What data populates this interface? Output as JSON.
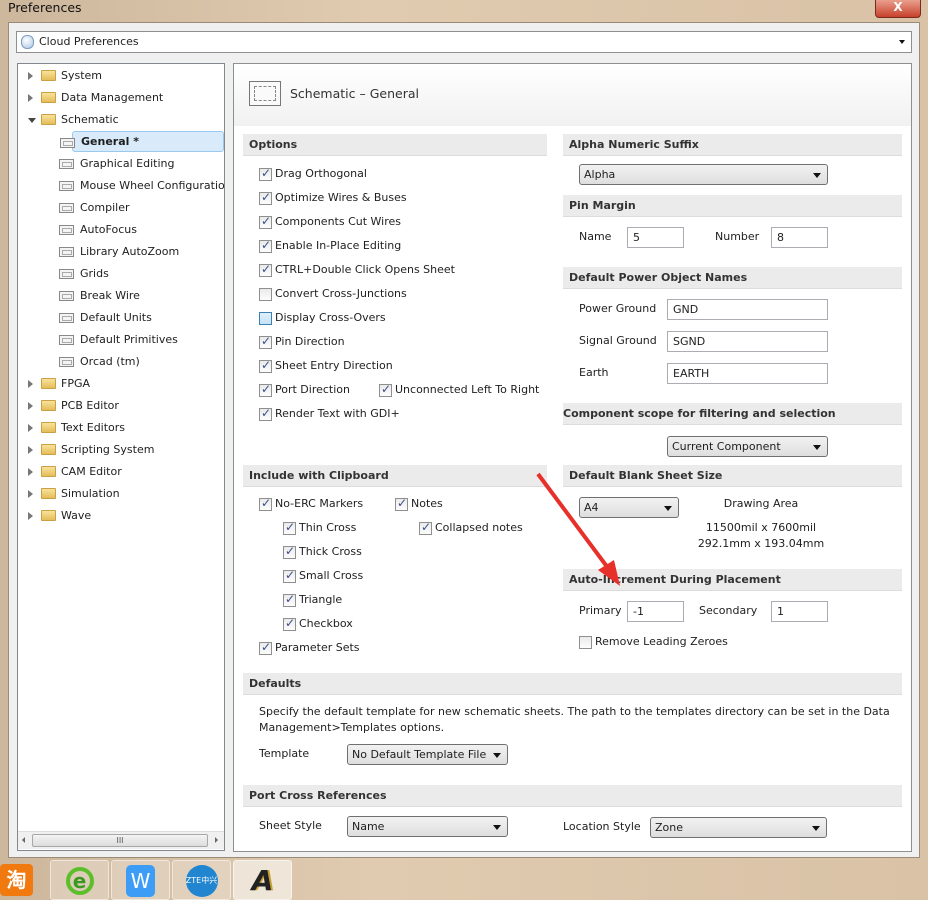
{
  "window": {
    "title": "Preferences",
    "close_label": "X"
  },
  "profile_select": {
    "value": "Cloud Preferences"
  },
  "tree": [
    {
      "label": "System",
      "level": 0,
      "expanded": false
    },
    {
      "label": "Data Management",
      "level": 0,
      "expanded": false
    },
    {
      "label": "Schematic",
      "level": 0,
      "expanded": true
    },
    {
      "label": "General *",
      "level": 1,
      "selected": true
    },
    {
      "label": "Graphical Editing",
      "level": 1
    },
    {
      "label": "Mouse Wheel Configuration",
      "level": 1
    },
    {
      "label": "Compiler",
      "level": 1
    },
    {
      "label": "AutoFocus",
      "level": 1
    },
    {
      "label": "Library AutoZoom",
      "level": 1
    },
    {
      "label": "Grids",
      "level": 1
    },
    {
      "label": "Break Wire",
      "level": 1
    },
    {
      "label": "Default Units",
      "level": 1
    },
    {
      "label": "Default Primitives",
      "level": 1
    },
    {
      "label": "Orcad (tm)",
      "level": 1
    },
    {
      "label": "FPGA",
      "level": 0,
      "expanded": false
    },
    {
      "label": "PCB Editor",
      "level": 0,
      "expanded": false
    },
    {
      "label": "Text Editors",
      "level": 0,
      "expanded": false
    },
    {
      "label": "Scripting System",
      "level": 0,
      "expanded": false
    },
    {
      "label": "CAM Editor",
      "level": 0,
      "expanded": false
    },
    {
      "label": "Simulation",
      "level": 0,
      "expanded": false
    },
    {
      "label": "Wave",
      "level": 0,
      "expanded": false
    }
  ],
  "scroll_grip": "III",
  "page": {
    "title": "Schematic – General"
  },
  "options": {
    "header": "Options",
    "items": [
      {
        "label": "Drag Orthogonal",
        "checked": true
      },
      {
        "label": "Optimize Wires & Buses",
        "checked": true
      },
      {
        "label": "Components Cut Wires",
        "checked": true
      },
      {
        "label": "Enable In-Place Editing",
        "checked": true
      },
      {
        "label": "CTRL+Double Click Opens Sheet",
        "checked": true
      },
      {
        "label": "Convert Cross-Junctions",
        "checked": false
      },
      {
        "label": "Display Cross-Overs",
        "checked": false
      },
      {
        "label": "Pin Direction",
        "checked": true
      },
      {
        "label": "Sheet Entry Direction",
        "checked": true
      },
      {
        "label": "Port Direction",
        "checked": true
      },
      {
        "label": "Unconnected Left To Right",
        "checked": true
      },
      {
        "label": "Render Text with GDI+",
        "checked": true
      }
    ]
  },
  "clipboard": {
    "header": "Include with Clipboard",
    "items": [
      {
        "label": "No-ERC Markers",
        "checked": true
      },
      {
        "label": "Notes",
        "checked": true
      },
      {
        "label": "Thin Cross",
        "checked": true
      },
      {
        "label": "Collapsed notes",
        "checked": true
      },
      {
        "label": "Thick Cross",
        "checked": true
      },
      {
        "label": "Small Cross",
        "checked": true
      },
      {
        "label": "Triangle",
        "checked": true
      },
      {
        "label": "Checkbox",
        "checked": true
      },
      {
        "label": "Parameter Sets",
        "checked": true
      }
    ]
  },
  "alpha": {
    "header": "Alpha Numeric Suffix",
    "value": "Alpha"
  },
  "pin_margin": {
    "header": "Pin Margin",
    "name_label": "Name",
    "name_value": "5",
    "number_label": "Number",
    "number_value": "8"
  },
  "power": {
    "header": "Default Power Object Names",
    "power_ground_label": "Power Ground",
    "power_ground": "GND",
    "signal_ground_label": "Signal Ground",
    "signal_ground": "SGND",
    "earth_label": "Earth",
    "earth": "EARTH"
  },
  "scope": {
    "header": "Component scope for filtering and selection",
    "value": "Current Component"
  },
  "sheet_size": {
    "header": "Default Blank Sheet Size",
    "value": "A4",
    "area_label": "Drawing Area",
    "mil": "11500mil x 7600mil",
    "mm": "292.1mm x 193.04mm"
  },
  "auto_increment": {
    "header": "Auto-Increment During Placement",
    "primary_label": "Primary",
    "primary": "-1",
    "secondary_label": "Secondary",
    "secondary": "1",
    "remove_zeroes": {
      "label": "Remove Leading Zeroes",
      "checked": false
    }
  },
  "defaults": {
    "header": "Defaults",
    "text1": "Specify the default template for new schematic sheets.  The path to the templates directory can be set in the Data",
    "text2": "Management>Templates options.",
    "template_label": "Template",
    "template_value": "No Default Template File"
  },
  "port_cross": {
    "header": "Port Cross References",
    "sheet_style_label": "Sheet Style",
    "sheet_style": "Name",
    "location_style_label": "Location Style",
    "location_style": "Zone"
  },
  "colors": {
    "annotation_arrow": "#e8302a",
    "selection": "#d9ebfa"
  },
  "taskbar": {
    "apps": [
      "taobao-icon",
      "ie-icon",
      "wps-icon",
      "zte-icon",
      "altium-icon"
    ],
    "zte_label": "ZTE中兴",
    "taobao_label": "淘"
  }
}
